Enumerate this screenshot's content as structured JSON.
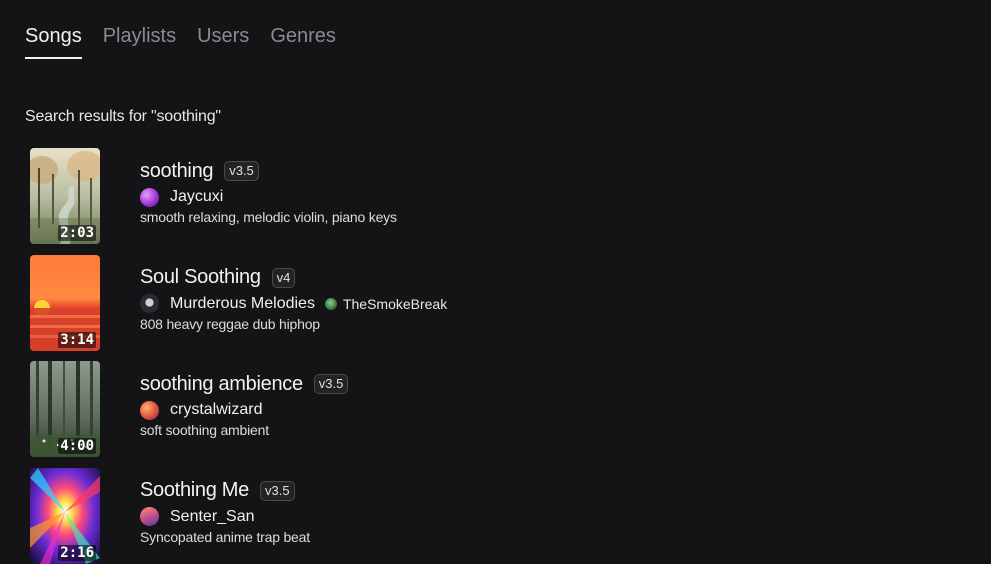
{
  "tabs": [
    {
      "label": "Songs",
      "active": true
    },
    {
      "label": "Playlists",
      "active": false
    },
    {
      "label": "Users",
      "active": false
    },
    {
      "label": "Genres",
      "active": false
    }
  ],
  "search": {
    "heading": "Search results for \"soothing\""
  },
  "results": [
    {
      "title": "soothing",
      "version": "v3.5",
      "duration": "2:03",
      "artist": "Jaycuxi",
      "artist_avatar": "purple-orb-avatar",
      "featured_artist": null,
      "description": "smooth relaxing, melodic violin, piano keys",
      "thumbnail": "misty-forest-stream-art"
    },
    {
      "title": "Soul Soothing",
      "version": "v4",
      "duration": "3:14",
      "artist": "Murderous Melodies",
      "artist_avatar": "skull-avatar",
      "featured_artist": "TheSmokeBreak",
      "featured_avatar": "green-leaf-avatar",
      "description": "808 heavy reggae dub hiphop",
      "thumbnail": "ocean-sunset-art"
    },
    {
      "title": "soothing ambience",
      "version": "v3.5",
      "duration": "4:00",
      "artist": "crystalwizard",
      "artist_avatar": "orange-orb-avatar",
      "featured_artist": null,
      "description": "soft soothing ambient",
      "thumbnail": "dark-forest-art"
    },
    {
      "title": "Soothing Me",
      "version": "v3.5",
      "duration": "2:16",
      "artist": "Senter_San",
      "artist_avatar": "sunset-orb-avatar",
      "featured_artist": null,
      "description": "Syncopated anime trap beat",
      "thumbnail": "color-explosion-art"
    }
  ],
  "colors": {
    "background": "#141416",
    "text_primary": "#f2f2f2",
    "tab_inactive": "#8a8a90"
  }
}
